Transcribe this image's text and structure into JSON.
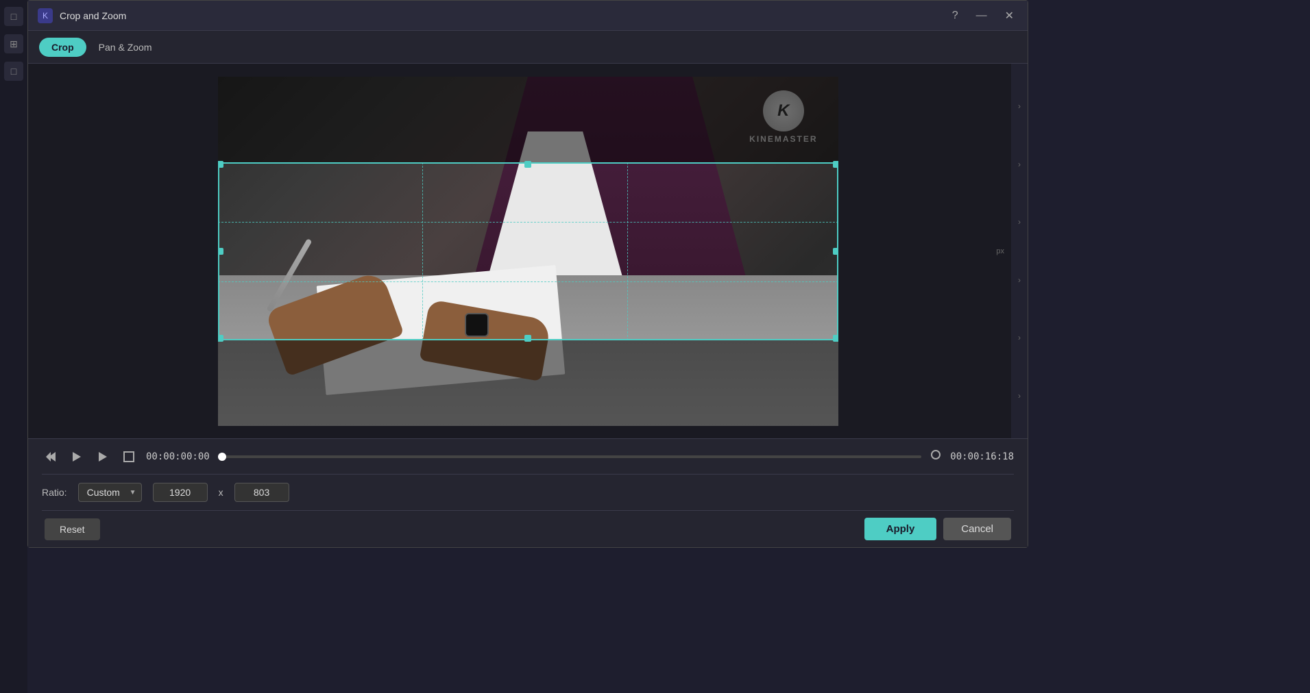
{
  "window": {
    "title": "Crop and Zoom",
    "app_icon": "K"
  },
  "tabs": [
    {
      "id": "crop",
      "label": "Crop",
      "active": true
    },
    {
      "id": "pan_zoom",
      "label": "Pan & Zoom",
      "active": false
    }
  ],
  "toolbar": {
    "help_icon": "?",
    "minimize_icon": "—",
    "close_icon": "✕"
  },
  "playback": {
    "time_current": "00:00:00:00",
    "time_total": "00:00:16:18",
    "back_frame_icon": "⏮",
    "play_icon": "▶",
    "play_icon2": "▶",
    "fullscreen_icon": "□",
    "loop_icon": "○"
  },
  "ratio": {
    "label": "Ratio:",
    "value": "Custom",
    "width": "1920",
    "height": "803",
    "x_label": "x"
  },
  "kinemaster": {
    "letter": "K",
    "name": "KINEMASTER"
  },
  "actions": {
    "reset_label": "Reset",
    "apply_label": "Apply",
    "cancel_label": "Cancel"
  },
  "colors": {
    "accent": "#4ecdc4",
    "bg_dark": "#252530",
    "bg_darker": "#1a1a22"
  },
  "sidebar_arrows": [
    "›",
    "›",
    "›",
    "›",
    "›",
    "›"
  ],
  "left_icons": [
    "□",
    "⊞",
    "□"
  ]
}
